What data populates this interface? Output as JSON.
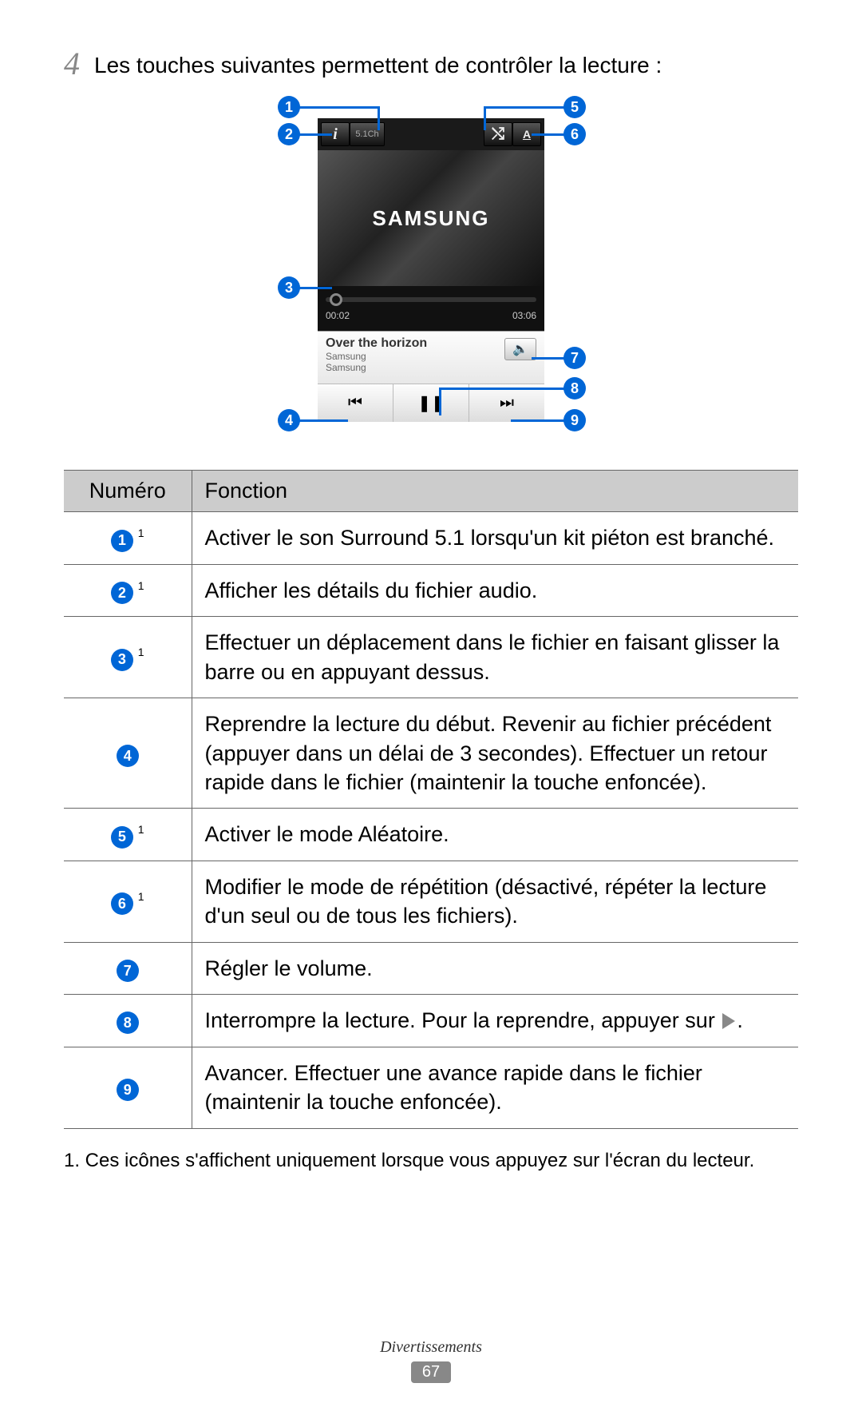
{
  "step": {
    "num": "4",
    "text": "Les touches suivantes permettent de contrôler la lecture :"
  },
  "phone": {
    "brand": "SAMSUNG",
    "channel": "5.1Ch",
    "repeatLetter": "A",
    "timeElapsed": "00:02",
    "timeTotal": "03:06",
    "trackTitle": "Over the horizon",
    "artist": "Samsung",
    "album": "Samsung"
  },
  "tableHeader": {
    "num": "Numéro",
    "func": "Fonction"
  },
  "rows": [
    {
      "num": "1",
      "sup": " 1",
      "func": "Activer le son Surround 5.1 lorsqu'un kit piéton est branché."
    },
    {
      "num": "2",
      "sup": " 1",
      "func": "Afficher les détails du fichier audio."
    },
    {
      "num": "3",
      "sup": " 1",
      "func": "Effectuer un déplacement dans le fichier en faisant glisser la barre ou en appuyant dessus."
    },
    {
      "num": "4",
      "sup": "",
      "func": "Reprendre la lecture du début. Revenir au fichier précédent (appuyer dans un délai de 3 secondes). Effectuer un retour rapide dans le fichier (maintenir la touche enfoncée)."
    },
    {
      "num": "5",
      "sup": " 1",
      "func": "Activer le mode Aléatoire."
    },
    {
      "num": "6",
      "sup": " 1",
      "func": "Modifier le mode de répétition (désactivé, répéter la lecture d'un seul ou de tous les fichiers)."
    },
    {
      "num": "7",
      "sup": "",
      "func": "Régler le volume."
    },
    {
      "num": "8",
      "sup": "",
      "funcPre": "Interrompre la lecture. Pour la reprendre, appuyer sur ",
      "funcPost": "."
    },
    {
      "num": "9",
      "sup": "",
      "func": "Avancer. Effectuer une avance rapide dans le fichier (maintenir la touche enfoncée)."
    }
  ],
  "footnote": "1.  Ces icônes s'affichent uniquement lorsque vous appuyez sur l'écran du lecteur.",
  "footer": {
    "category": "Divertissements",
    "page": "67"
  }
}
